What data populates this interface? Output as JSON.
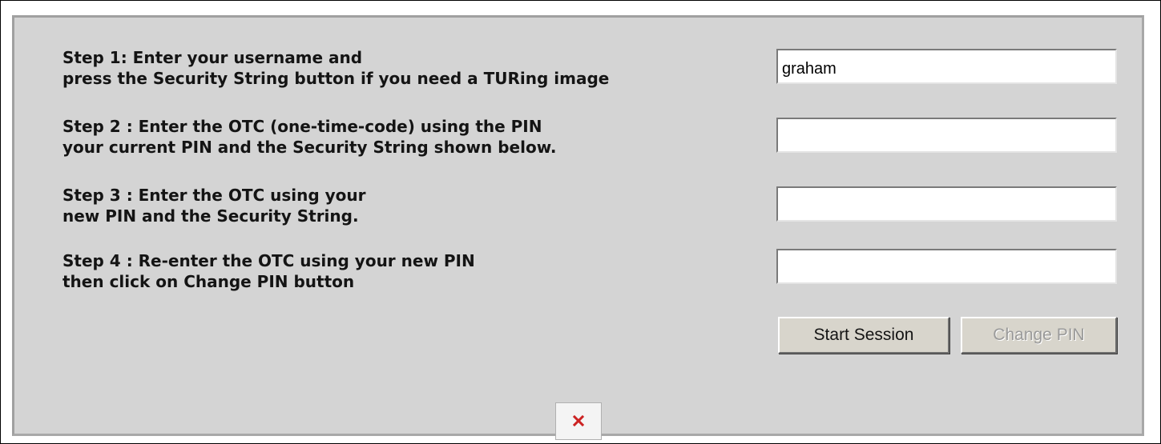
{
  "steps": [
    {
      "line1": "Step 1: Enter your username and",
      "line2": "press the Security String button if you need a TURing image"
    },
    {
      "line1": "Step 2 : Enter the OTC (one-time-code) using the PIN",
      "line2": "your current PIN and the Security String shown below."
    },
    {
      "line1": "Step 3 : Enter the OTC using your",
      "line2": "new PIN and the Security String."
    },
    {
      "line1": "Step 4 : Re-enter the OTC using your new PIN",
      "line2": "then click on Change PIN button"
    }
  ],
  "fields": {
    "username_value": "graham",
    "otc_current_value": "",
    "otc_new_value": "",
    "otc_reenter_value": ""
  },
  "buttons": {
    "start_session_label": "Start Session",
    "change_pin_label": "Change PIN",
    "change_pin_disabled": true
  },
  "icons": {
    "broken_image": "broken-image-icon"
  },
  "colors": {
    "panel_background": "#d4d4d4",
    "broken_image_x": "#cc2222",
    "disabled_text": "#9a9a9a"
  }
}
